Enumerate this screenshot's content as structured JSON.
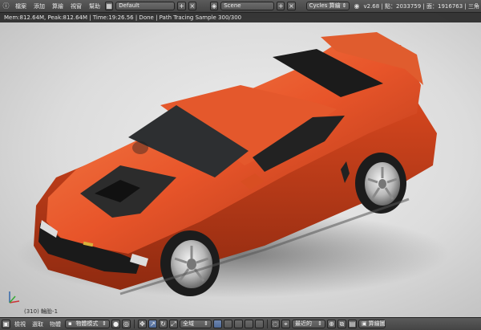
{
  "top_bar": {
    "menus": [
      "檔案",
      "添加",
      "算繪",
      "視窗",
      "幫助"
    ],
    "layout": "Default",
    "scene": "Scene",
    "engine": "Cycles 算繪",
    "stats": "v2.68 | 點：2033759 | 面：1916763 | 三角"
  },
  "viewport": {
    "render_info": "Mem:812.64M, Peak:812.64M | Time:19:26.56 | Done | Path Tracing Sample 300/300",
    "frame_label": "(310) 輪胎-1",
    "car_color": "#e8552a"
  },
  "bottom_bar": {
    "menus": [
      "檢視",
      "選取",
      "物體"
    ],
    "mode": "物體模式",
    "pivot": "全域",
    "snap": "最近的",
    "render_button": "算繪圖"
  },
  "colors": {
    "header_bg": "#4a4a4a",
    "accent": "#5680c2",
    "car_orange": "#e8552a"
  }
}
